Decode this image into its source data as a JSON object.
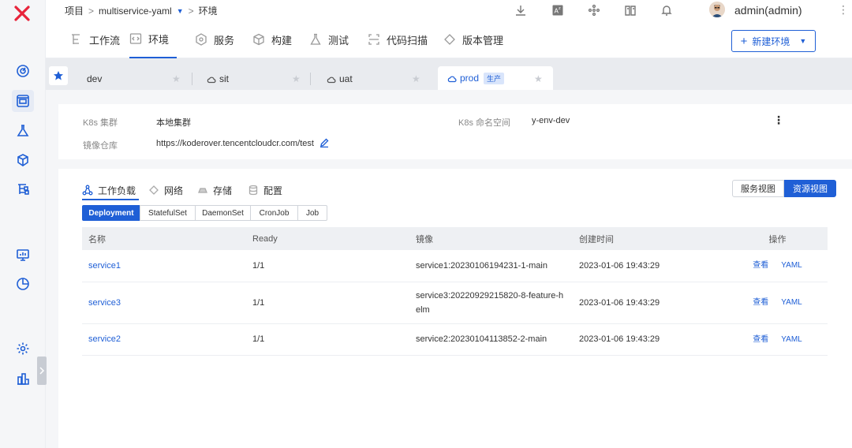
{
  "colors": {
    "accent": "#1f5fd6",
    "logo": "#e8243b",
    "page_bg": "#f5f6f8"
  },
  "breadcrumb": {
    "project": "项目",
    "sep": ">",
    "project_name": "multiservice-yaml",
    "current": "环境"
  },
  "header": {
    "icons": [
      "download-icon",
      "translate-icon",
      "plugin-icon",
      "docs-icon",
      "bell-icon"
    ],
    "user": "admin(admin)"
  },
  "sidebar": {
    "icons": [
      "dashboard-icon",
      "projects-icon",
      "test-flask-icon",
      "artifact-icon",
      "workflow-icon",
      "monitor-icon",
      "analytics-icon",
      "settings-icon",
      "system-icon"
    ],
    "active": "projects-icon"
  },
  "main_tabs": [
    {
      "label": "工作流",
      "icon": "workflow-icon"
    },
    {
      "label": "环境",
      "icon": "code-icon",
      "active": true
    },
    {
      "label": "服务",
      "icon": "service-icon"
    },
    {
      "label": "构建",
      "icon": "build-icon"
    },
    {
      "label": "测试",
      "icon": "flask-icon"
    },
    {
      "label": "代码扫描",
      "icon": "scan-icon"
    },
    {
      "label": "版本管理",
      "icon": "version-icon"
    }
  ],
  "new_env_button": {
    "label": "新建环境"
  },
  "env_tabs": [
    {
      "name": "dev"
    },
    {
      "name": "sit"
    },
    {
      "name": "uat"
    },
    {
      "name": "prod",
      "badge": "生产",
      "active": true
    }
  ],
  "env_info": {
    "cluster_label": "K8s 集群",
    "cluster_value": "本地集群",
    "namespace_label": "K8s 命名空间",
    "namespace_value": "y-env-dev",
    "registry_label": "镜像仓库",
    "registry_value": "https://koderover.tencentcloudcr.com/test"
  },
  "workload_tabs": [
    {
      "label": "工作负载",
      "active": true
    },
    {
      "label": "网络"
    },
    {
      "label": "存储"
    },
    {
      "label": "配置"
    }
  ],
  "view_toggle": {
    "service_view": "服务视图",
    "resource_view": "资源视图",
    "active": "resource_view"
  },
  "kinds": [
    "Deployment",
    "StatefulSet",
    "DaemonSet",
    "CronJob",
    "Job"
  ],
  "kind_active": "Deployment",
  "table": {
    "headers": [
      "名称",
      "Ready",
      "镜像",
      "创建时间",
      "操作"
    ],
    "rows": [
      {
        "name": "service1",
        "ready": "1/1",
        "image": "service1:20230106194231-1-main",
        "created": "2023-01-06 19:43:29",
        "op_view": "查看",
        "op_yaml": "YAML"
      },
      {
        "name": "service3",
        "ready": "1/1",
        "image_line1": "service3:20220929215820-8-feature-h",
        "image_line2": "elm",
        "created": "2023-01-06 19:43:29",
        "op_view": "查看",
        "op_yaml": "YAML"
      },
      {
        "name": "service2",
        "ready": "1/1",
        "image": "service2:20230104113852-2-main",
        "created": "2023-01-06 19:43:29",
        "op_view": "查看",
        "op_yaml": "YAML"
      }
    ]
  }
}
